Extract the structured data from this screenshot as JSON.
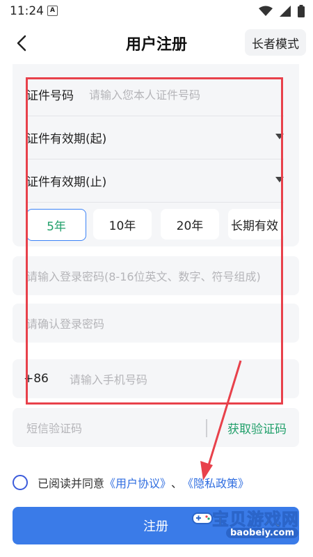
{
  "status": {
    "time": "11:24",
    "app_icon": "A"
  },
  "header": {
    "title": "用户注册",
    "elder_mode": "长者模式"
  },
  "form": {
    "id_number": {
      "label": "证件号码",
      "placeholder": "请输入您本人证件号码"
    },
    "valid_from": {
      "label": "证件有效期(起)"
    },
    "valid_to": {
      "label": "证件有效期(止)"
    },
    "periods": [
      "5年",
      "10年",
      "20年",
      "长期有效"
    ],
    "selected_period": "5年",
    "password": {
      "placeholder": "请输入登录密码(8-16位英文、数字、符号组成)"
    },
    "confirm_password": {
      "placeholder": "请确认登录密码"
    },
    "phone": {
      "prefix": "+86",
      "placeholder": "请输入手机号码"
    },
    "sms": {
      "placeholder": "短信验证码",
      "get_code": "获取验证码"
    }
  },
  "agreement": {
    "text": "已阅读并同意",
    "user_agreement": "《用户协议》",
    "separator": "、",
    "privacy": "《隐私政策》"
  },
  "register_button": "注册",
  "watermark": {
    "title": "宝贝游戏网",
    "url": "baobeiy.com"
  },
  "colors": {
    "accent": "#3a7be8",
    "green": "#22a06b",
    "highlight": "#e8414b"
  }
}
